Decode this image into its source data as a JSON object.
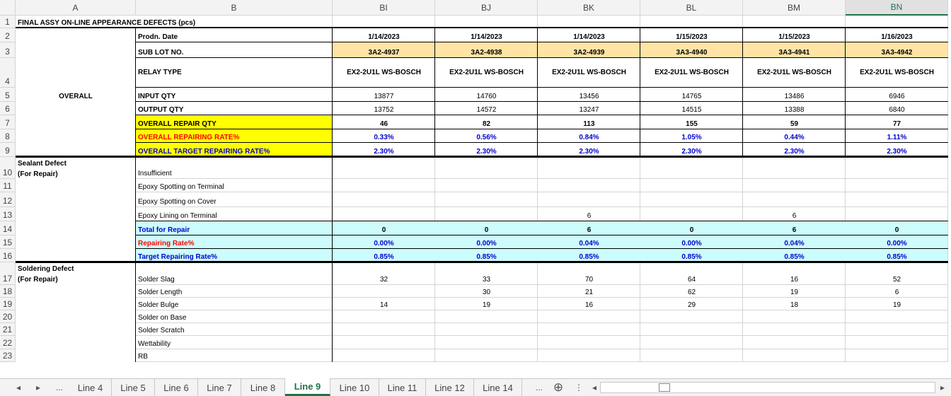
{
  "columns": [
    "A",
    "B",
    "BI",
    "BJ",
    "BK",
    "BL",
    "BM",
    "BN"
  ],
  "selected_column": "BN",
  "row_numbers": [
    "1",
    "2",
    "3",
    "4",
    "5",
    "6",
    "7",
    "8",
    "9",
    "10",
    "11",
    "12",
    "13",
    "14",
    "15",
    "16",
    "17",
    "18",
    "19",
    "20",
    "21",
    "22",
    "23"
  ],
  "title": "FINAL ASSY ON-LINE APPEARANCE DEFECTS (pcs)",
  "colors": {
    "sublot_fill": "#ffe4a6",
    "yellow_fill": "#ffff00",
    "cyan_fill": "#ccfcfc",
    "red_text": "#ff0000",
    "blue_text": "#0000cc",
    "selected_header": "#217346"
  },
  "sections": {
    "overall": "OVERALL",
    "sealant_line1": "Sealant Defect",
    "sealant_line2": "(For Repair)",
    "soldering_line1": "Soldering Defect",
    "soldering_line2": "(For Repair)"
  },
  "labels": {
    "prodn_date": "Prodn. Date",
    "sub_lot": "SUB LOT NO.",
    "relay_type": "RELAY TYPE",
    "input_qty": "INPUT QTY",
    "output_qty": "OUTPUT QTY",
    "overall_repair_qty": "OVERALL REPAIR QTY",
    "overall_repairing_rate": "OVERALL REPAIRING RATE%",
    "overall_target_rate": "OVERALL TARGET REPAIRING RATE%",
    "insufficient": "Insufficient",
    "epoxy_terminal": "Epoxy Spotting on Terminal",
    "epoxy_cover": "Epoxy Spotting on Cover",
    "epoxy_lining": "Epoxy Lining on Terminal",
    "total_repair": "Total for Repair",
    "repairing_rate": "Repairing Rate%",
    "target_rate": "Target Repairing Rate%",
    "solder_slag": "Solder Slag",
    "solder_length": "Solder Length",
    "solder_bulge": "Solder Bulge",
    "solder_base": "Solder on Base",
    "solder_scratch": "Solder Scratch",
    "wettability": "Wettability",
    "rb": "RB"
  },
  "data": {
    "prodn_date": [
      "1/14/2023",
      "1/14/2023",
      "1/14/2023",
      "1/15/2023",
      "1/15/2023",
      "1/16/2023"
    ],
    "sub_lot": [
      "3A2-4937",
      "3A2-4938",
      "3A2-4939",
      "3A3-4940",
      "3A3-4941",
      "3A3-4942"
    ],
    "relay_type": [
      "EX2-2U1L WS-BOSCH",
      "EX2-2U1L WS-BOSCH",
      "EX2-2U1L WS-BOSCH",
      "EX2-2U1L WS-BOSCH",
      "EX2-2U1L WS-BOSCH",
      "EX2-2U1L WS-BOSCH"
    ],
    "input_qty": [
      "13877",
      "14760",
      "13456",
      "14765",
      "13486",
      "6946"
    ],
    "output_qty": [
      "13752",
      "14572",
      "13247",
      "14515",
      "13388",
      "6840"
    ],
    "overall_repair_qty": [
      "46",
      "82",
      "113",
      "155",
      "59",
      "77"
    ],
    "overall_repairing_rate": [
      "0.33%",
      "0.56%",
      "0.84%",
      "1.05%",
      "0.44%",
      "1.11%"
    ],
    "overall_target_rate": [
      "2.30%",
      "2.30%",
      "2.30%",
      "2.30%",
      "2.30%",
      "2.30%"
    ],
    "insufficient": [
      "",
      "",
      "",
      "",
      "",
      ""
    ],
    "epoxy_terminal": [
      "",
      "",
      "",
      "",
      "",
      ""
    ],
    "epoxy_cover": [
      "",
      "",
      "",
      "",
      "",
      ""
    ],
    "epoxy_lining": [
      "",
      "",
      "6",
      "",
      "6",
      ""
    ],
    "total_repair": [
      "0",
      "0",
      "6",
      "0",
      "6",
      "0"
    ],
    "repairing_rate": [
      "0.00%",
      "0.00%",
      "0.04%",
      "0.00%",
      "0.04%",
      "0.00%"
    ],
    "target_rate": [
      "0.85%",
      "0.85%",
      "0.85%",
      "0.85%",
      "0.85%",
      "0.85%"
    ],
    "solder_slag": [
      "32",
      "33",
      "70",
      "64",
      "16",
      "52"
    ],
    "solder_length": [
      "",
      "30",
      "21",
      "62",
      "19",
      "6"
    ],
    "solder_bulge": [
      "14",
      "19",
      "16",
      "29",
      "18",
      "19"
    ],
    "solder_base": [
      "",
      "",
      "",
      "",
      "",
      ""
    ],
    "solder_scratch": [
      "",
      "",
      "",
      "",
      "",
      ""
    ],
    "wettability": [
      "",
      "",
      "",
      "",
      "",
      ""
    ],
    "rb": [
      "",
      "",
      "",
      "",
      "",
      ""
    ]
  },
  "tabs": [
    "Line 4",
    "Line 5",
    "Line 6",
    "Line 7",
    "Line 8",
    "Line 9",
    "Line 10",
    "Line 11",
    "Line 12",
    "Line 14"
  ],
  "active_tab": "Line 9",
  "tabbar_icons": {
    "prev": "triangle-left-icon",
    "next": "triangle-right-icon",
    "more_left": "ellipsis-icon",
    "more_right": "ellipsis-icon",
    "add": "plus-circle-icon",
    "split": "vertical-dots-icon",
    "scroll_left": "scroll-left-icon",
    "scroll_right": "scroll-right-icon"
  },
  "tabbar_glyphs": {
    "prev": "◂",
    "next": "▸",
    "more": "...",
    "add": "⊕",
    "split": "⋮",
    "scroll_left": "◂",
    "scroll_right": "▸"
  }
}
